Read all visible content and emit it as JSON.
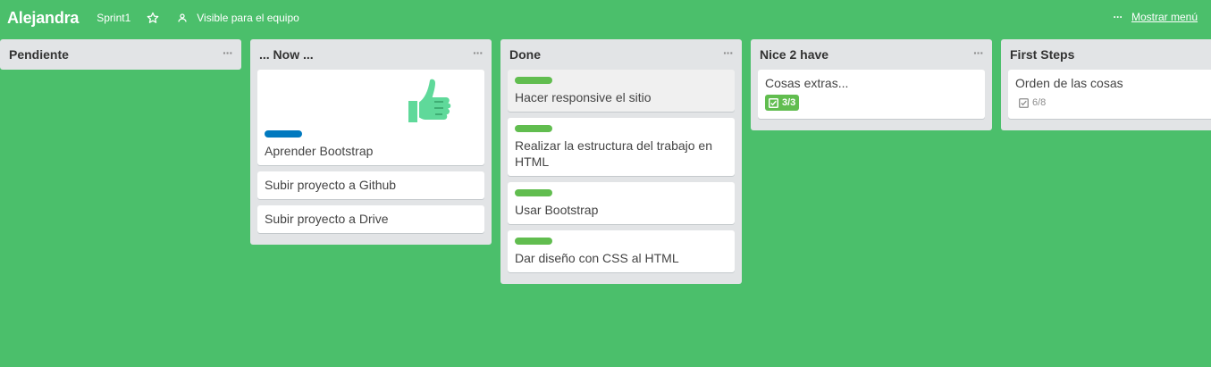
{
  "header": {
    "board_title": "Alejandra",
    "sprint": "Sprint1",
    "visibility": "Visible para el equipo",
    "menu_dots": "···",
    "show_menu": "Mostrar menú"
  },
  "colors": {
    "background": "#4bbf6b",
    "list_bg": "#e2e4e6",
    "label_green": "#61bd4f",
    "label_blue": "#0079bf"
  },
  "lists": [
    {
      "title": "Pendiente",
      "menu": "···",
      "cards": []
    },
    {
      "title": "... Now ...",
      "menu": "···",
      "cards": [
        {
          "title": "Aprender Bootstrap",
          "label": "blue",
          "sticker": "thumbs-up-icon"
        },
        {
          "title": "Subir proyecto a Github"
        },
        {
          "title": "Subir proyecto a Drive"
        }
      ]
    },
    {
      "title": "Done",
      "menu": "···",
      "cards": [
        {
          "title": "Hacer responsive el sitio",
          "label": "green"
        },
        {
          "title": "Realizar la estructura del trabajo en HTML",
          "label": "green"
        },
        {
          "title": "Usar Bootstrap",
          "label": "green"
        },
        {
          "title": "Dar diseño con CSS al HTML",
          "label": "green"
        }
      ]
    },
    {
      "title": "Nice 2 have",
      "menu": "···",
      "cards": [
        {
          "title": "Cosas extras...",
          "checklist": "3/3"
        }
      ]
    },
    {
      "title": "First Steps",
      "menu": "···",
      "cards": [
        {
          "title": "Orden de las cosas",
          "checklist": "6/8"
        }
      ]
    }
  ]
}
